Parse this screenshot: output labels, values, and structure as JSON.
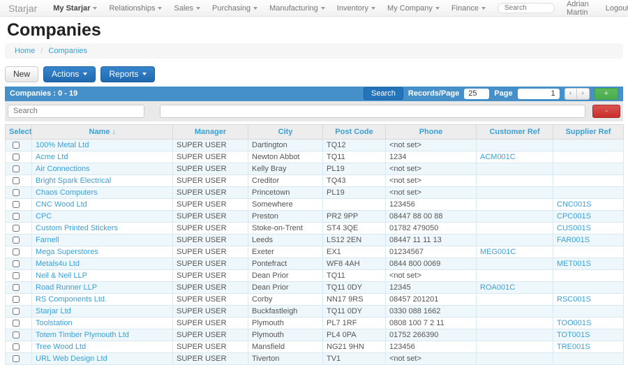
{
  "colors": {
    "accent_link_blue": "#39a0d8",
    "list_bar_blue": "#4690ca",
    "primary_button_blue_top": "#3585cd",
    "primary_button_blue_bottom": "#2269ae",
    "add_button_green": "#5cb85c",
    "remove_button_red": "#d9534f",
    "row_stripe_blue": "#eef7fb"
  },
  "navbar": {
    "brand": "Starjar",
    "items": [
      "My Starjar",
      "Relationships",
      "Sales",
      "Purchasing",
      "Manufacturing",
      "Inventory",
      "My Company",
      "Finance"
    ],
    "search_placeholder": "Search",
    "user_name": "Adrian Martin",
    "logout_label": "Logout"
  },
  "page": {
    "title": "Companies",
    "breadcrumb_home": "Home",
    "breadcrumb_separator": "/",
    "breadcrumb_current": "Companies"
  },
  "toolbar": {
    "new_label": "New",
    "actions_label": "Actions",
    "reports_label": "Reports"
  },
  "list_bar": {
    "title": "Companies : 0 - 19",
    "search_button_label": "Search",
    "records_per_page_label": "Records/Page",
    "records_per_page_value": "25",
    "page_label": "Page",
    "page_value": "1",
    "prev_label": "‹",
    "next_label": "›",
    "add_label": "+"
  },
  "filter_row": {
    "field_placeholder": "Search",
    "value_text": "",
    "remove_label": "-"
  },
  "table": {
    "headers": [
      "Select",
      "Name",
      "Manager",
      "City",
      "Post Code",
      "Phone",
      "Customer Ref",
      "Supplier Ref"
    ],
    "sort_icon": "↓",
    "rows": [
      {
        "name": "100% Metal Ltd",
        "manager": "SUPER USER",
        "city": "Dartington",
        "post_code": "TQ12",
        "phone": "<not set>",
        "customer_ref": "",
        "supplier_ref": ""
      },
      {
        "name": "Acme Ltd",
        "manager": "SUPER USER",
        "city": "Newton Abbot",
        "post_code": "TQ11",
        "phone": "1234",
        "customer_ref": "ACM001C",
        "supplier_ref": ""
      },
      {
        "name": "Air Connections",
        "manager": "SUPER USER",
        "city": "Kelly Bray",
        "post_code": "PL19",
        "phone": "<not set>",
        "customer_ref": "",
        "supplier_ref": ""
      },
      {
        "name": "Bright Spark Electrical",
        "manager": "SUPER USER",
        "city": "Creditor",
        "post_code": "TQ43",
        "phone": "<not set>",
        "customer_ref": "",
        "supplier_ref": ""
      },
      {
        "name": "Chaos Computers",
        "manager": "SUPER USER",
        "city": "Princetown",
        "post_code": "PL19",
        "phone": "<not set>",
        "customer_ref": "",
        "supplier_ref": ""
      },
      {
        "name": "CNC Wood Ltd",
        "manager": "SUPER USER",
        "city": "Somewhere",
        "post_code": "",
        "phone": "123456",
        "customer_ref": "",
        "supplier_ref": "CNC001S"
      },
      {
        "name": "CPC",
        "manager": "SUPER USER",
        "city": "Preston",
        "post_code": "PR2 9PP",
        "phone": "08447 88 00 88",
        "customer_ref": "",
        "supplier_ref": "CPC001S"
      },
      {
        "name": "Custom Printed Stickers",
        "manager": "SUPER USER",
        "city": "Stoke-on-Trent",
        "post_code": "ST4 3QE",
        "phone": "01782 479050",
        "customer_ref": "",
        "supplier_ref": "CUS001S"
      },
      {
        "name": "Farnell",
        "manager": "SUPER USER",
        "city": "Leeds",
        "post_code": "LS12 2EN",
        "phone": "08447 11 11 13",
        "customer_ref": "",
        "supplier_ref": "FAR001S"
      },
      {
        "name": "Mega Superstores",
        "manager": "SUPER USER",
        "city": "Exeter",
        "post_code": "EX1",
        "phone": "01234567",
        "customer_ref": "MEG001C",
        "supplier_ref": ""
      },
      {
        "name": "Metals4u Ltd",
        "manager": "SUPER USER",
        "city": "Pontefract",
        "post_code": "WF8 4AH",
        "phone": "0844 800 0069",
        "customer_ref": "",
        "supplier_ref": "MET001S"
      },
      {
        "name": "Neil & Neil LLP",
        "manager": "SUPER USER",
        "city": "Dean Prior",
        "post_code": "TQ11",
        "phone": "<not set>",
        "customer_ref": "",
        "supplier_ref": ""
      },
      {
        "name": "Road Runner LLP",
        "manager": "SUPER USER",
        "city": "Dean Prior",
        "post_code": "TQ11 0DY",
        "phone": "12345",
        "customer_ref": "ROA001C",
        "supplier_ref": ""
      },
      {
        "name": "RS Components Ltd.",
        "manager": "SUPER USER",
        "city": "Corby",
        "post_code": "NN17 9RS",
        "phone": "08457 201201",
        "customer_ref": "",
        "supplier_ref": "RSC001S"
      },
      {
        "name": "Starjar Ltd",
        "manager": "SUPER USER",
        "city": "Buckfastleigh",
        "post_code": "TQ11 0DY",
        "phone": "0330 088 1662",
        "customer_ref": "",
        "supplier_ref": ""
      },
      {
        "name": "Toolstation",
        "manager": "SUPER USER",
        "city": "Plymouth",
        "post_code": "PL7 1RF",
        "phone": "0808 100 7 2 11",
        "customer_ref": "",
        "supplier_ref": "TOO001S"
      },
      {
        "name": "Totem Timber Plymouth Ltd",
        "manager": "SUPER USER",
        "city": "Plymouth",
        "post_code": "PL4 0PA",
        "phone": "01752 266390",
        "customer_ref": "",
        "supplier_ref": "TOT001S"
      },
      {
        "name": "Tree Wood Ltd",
        "manager": "SUPER USER",
        "city": "Mansfield",
        "post_code": "NG21 9HN",
        "phone": "123456",
        "customer_ref": "",
        "supplier_ref": "TRE001S"
      },
      {
        "name": "URL Web Design Ltd",
        "manager": "SUPER USER",
        "city": "Tiverton",
        "post_code": "TV1",
        "phone": "<not set>",
        "customer_ref": "",
        "supplier_ref": ""
      }
    ]
  }
}
